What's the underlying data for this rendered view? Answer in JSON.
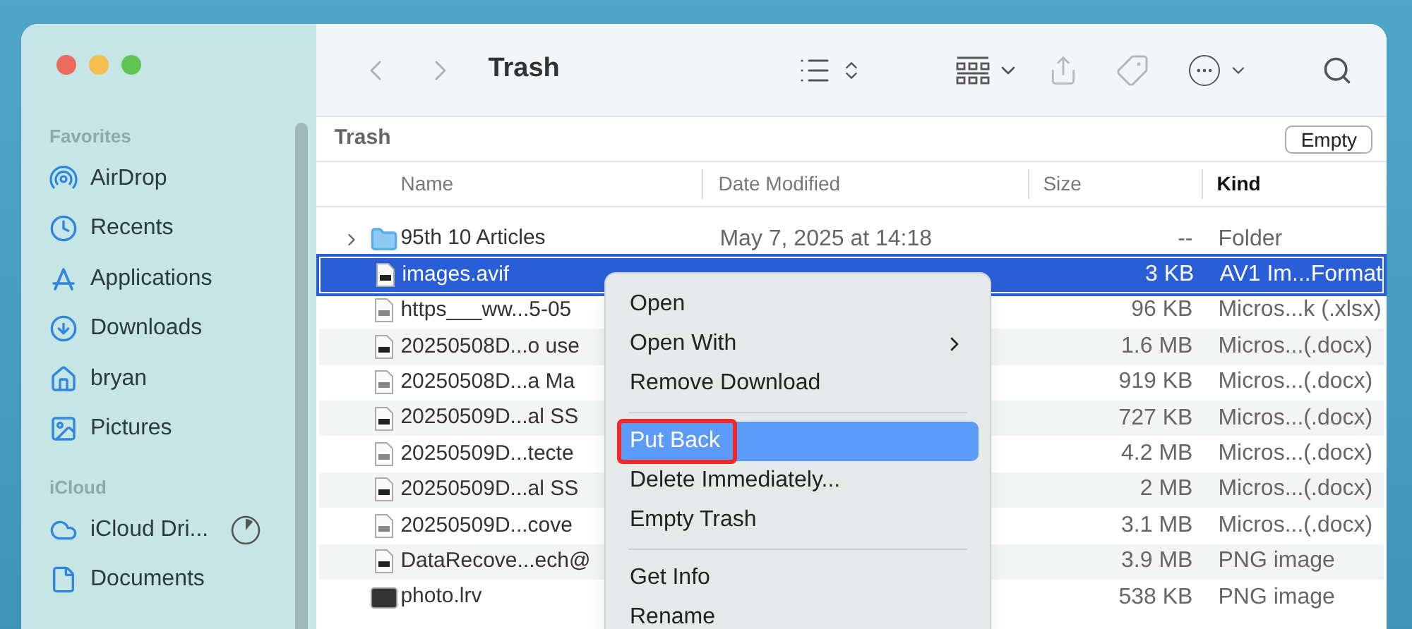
{
  "window": {
    "title": "Trash"
  },
  "sidebar": [
    {
      "header": "Favorites",
      "items": [
        {
          "label": "AirDrop"
        },
        {
          "label": "Recents"
        },
        {
          "label": "Applications"
        },
        {
          "label": "Downloads"
        },
        {
          "label": "bryan"
        },
        {
          "label": "Pictures"
        }
      ]
    },
    {
      "header": "iCloud",
      "items": [
        {
          "label": "iCloud Dri...",
          "syncing": true
        },
        {
          "label": "Documents"
        }
      ]
    }
  ],
  "path_bar": {
    "title": "Trash",
    "button": "Empty"
  },
  "table": {
    "columns": [
      {
        "label": "Name",
        "selected": false
      },
      {
        "label": "Date Modified",
        "selected": false
      },
      {
        "label": "Size",
        "selected": false
      },
      {
        "label": "Kind",
        "selected": true
      }
    ],
    "rows": [
      {
        "kind": "folder",
        "name": "95th 10 Articles",
        "date": "May 7, 2025 at 14:18",
        "size": "--",
        "type": "Folder",
        "selected": false
      },
      {
        "kind": "file",
        "name": "images.avif",
        "size": "3 KB",
        "type": "AV1 Im...Format",
        "selected": true
      },
      {
        "kind": "file",
        "name": "https___ww...5-05",
        "size": "96 KB",
        "type": "Micros...k (.xlsx)",
        "selected": false
      },
      {
        "kind": "file",
        "name": "20250508D...o use",
        "size": "1.6 MB",
        "type": "Micros...(.docx)",
        "selected": false
      },
      {
        "kind": "file",
        "name": "20250508D...a Ma",
        "size": "919 KB",
        "type": "Micros...(.docx)",
        "selected": false
      },
      {
        "kind": "file",
        "name": "20250509D...al SS",
        "size": "727 KB",
        "type": "Micros...(.docx)",
        "selected": false
      },
      {
        "kind": "file",
        "name": "20250509D...tecte",
        "size": "4.2 MB",
        "type": "Micros...(.docx)",
        "selected": false
      },
      {
        "kind": "file",
        "name": "20250509D...al SS",
        "size": "2 MB",
        "type": "Micros...(.docx)",
        "selected": false
      },
      {
        "kind": "file",
        "name": "20250509D...cove",
        "size": "3.1 MB",
        "type": "Micros...(.docx)",
        "selected": false
      },
      {
        "kind": "file",
        "name": "DataRecove...ech@",
        "size": "3.9 MB",
        "type": "PNG image",
        "selected": false
      },
      {
        "kind": "image",
        "name": "photo.lrv",
        "size": "538 KB",
        "type": "PNG image",
        "selected": false
      }
    ]
  },
  "context_menu": [
    {
      "kind": "item",
      "label": "Open",
      "submenu": false,
      "selected": false,
      "annotated": false
    },
    {
      "kind": "item",
      "label": "Open With",
      "submenu": true,
      "selected": false,
      "annotated": false
    },
    {
      "kind": "item",
      "label": "Remove Download",
      "submenu": false,
      "selected": false,
      "annotated": false
    },
    {
      "kind": "separator"
    },
    {
      "kind": "item",
      "label": "Put Back",
      "submenu": false,
      "selected": true,
      "annotated": true
    },
    {
      "kind": "item",
      "label": "Delete Immediately...",
      "submenu": false,
      "selected": false,
      "annotated": false
    },
    {
      "kind": "item",
      "label": "Empty Trash",
      "submenu": false,
      "selected": false,
      "annotated": false
    },
    {
      "kind": "separator"
    },
    {
      "kind": "item",
      "label": "Get Info",
      "submenu": false,
      "selected": false,
      "annotated": false
    },
    {
      "kind": "item",
      "label": "Rename",
      "submenu": false,
      "selected": false,
      "annotated": false
    }
  ]
}
